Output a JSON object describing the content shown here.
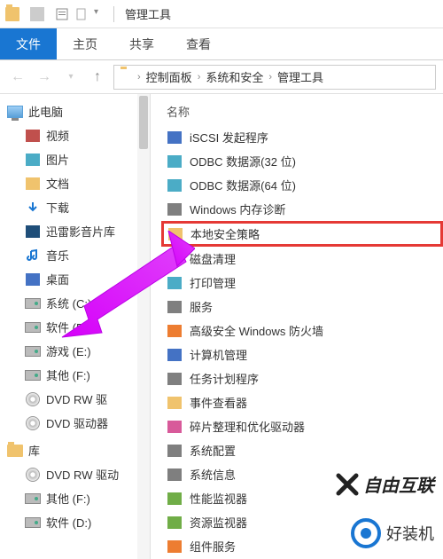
{
  "window": {
    "title": "管理工具"
  },
  "ribbon": {
    "tabs": [
      {
        "label": "文件",
        "active": true
      },
      {
        "label": "主页",
        "active": false
      },
      {
        "label": "共享",
        "active": false
      },
      {
        "label": "查看",
        "active": false
      }
    ]
  },
  "breadcrumb": {
    "items": [
      "控制面板",
      "系统和安全",
      "管理工具"
    ]
  },
  "sidebar": {
    "root": "此电脑",
    "items": [
      {
        "label": "视频",
        "color": "c-red"
      },
      {
        "label": "图片",
        "color": "c-teal"
      },
      {
        "label": "文档",
        "color": "c-yel"
      },
      {
        "label": "下载",
        "icon": "download"
      },
      {
        "label": "迅雷影音片库",
        "color": "c-dblue"
      },
      {
        "label": "音乐",
        "icon": "music"
      },
      {
        "label": "桌面",
        "color": "c-blue"
      },
      {
        "label": "系统 (C:)",
        "icon": "drive"
      },
      {
        "label": "软件 (D:)",
        "icon": "drive"
      },
      {
        "label": "游戏 (E:)",
        "icon": "drive"
      },
      {
        "label": "其他 (F:)",
        "icon": "drive"
      },
      {
        "label": "DVD RW 驱",
        "icon": "dvd"
      },
      {
        "label": "DVD 驱动器",
        "icon": "dvd"
      }
    ],
    "lib_root": "库",
    "lib_items": [
      {
        "label": "DVD RW 驱动",
        "icon": "dvd"
      },
      {
        "label": "其他 (F:)",
        "icon": "drive"
      },
      {
        "label": "软件 (D:)",
        "icon": "drive"
      }
    ]
  },
  "filelist": {
    "header": "名称",
    "items": [
      {
        "label": "iSCSI 发起程序",
        "color": "c-blue"
      },
      {
        "label": "ODBC 数据源(32 位)",
        "color": "c-teal"
      },
      {
        "label": "ODBC 数据源(64 位)",
        "color": "c-teal"
      },
      {
        "label": "Windows 内存诊断",
        "color": "c-gray"
      },
      {
        "label": "本地安全策略",
        "color": "c-yel",
        "highlighted": true
      },
      {
        "label": "磁盘清理",
        "color": "c-gray"
      },
      {
        "label": "打印管理",
        "color": "c-teal"
      },
      {
        "label": "服务",
        "color": "c-gray"
      },
      {
        "label": "高级安全 Windows 防火墙",
        "color": "c-orange"
      },
      {
        "label": "计算机管理",
        "color": "c-blue"
      },
      {
        "label": "任务计划程序",
        "color": "c-gray"
      },
      {
        "label": "事件查看器",
        "color": "c-yel"
      },
      {
        "label": "碎片整理和优化驱动器",
        "color": "c-pink"
      },
      {
        "label": "系统配置",
        "color": "c-gray"
      },
      {
        "label": "系统信息",
        "color": "c-gray"
      },
      {
        "label": "性能监视器",
        "color": "c-green"
      },
      {
        "label": "资源监视器",
        "color": "c-green"
      },
      {
        "label": "组件服务",
        "color": "c-orange"
      }
    ]
  },
  "watermarks": {
    "w1": "自由互联",
    "w2": "好装机"
  }
}
